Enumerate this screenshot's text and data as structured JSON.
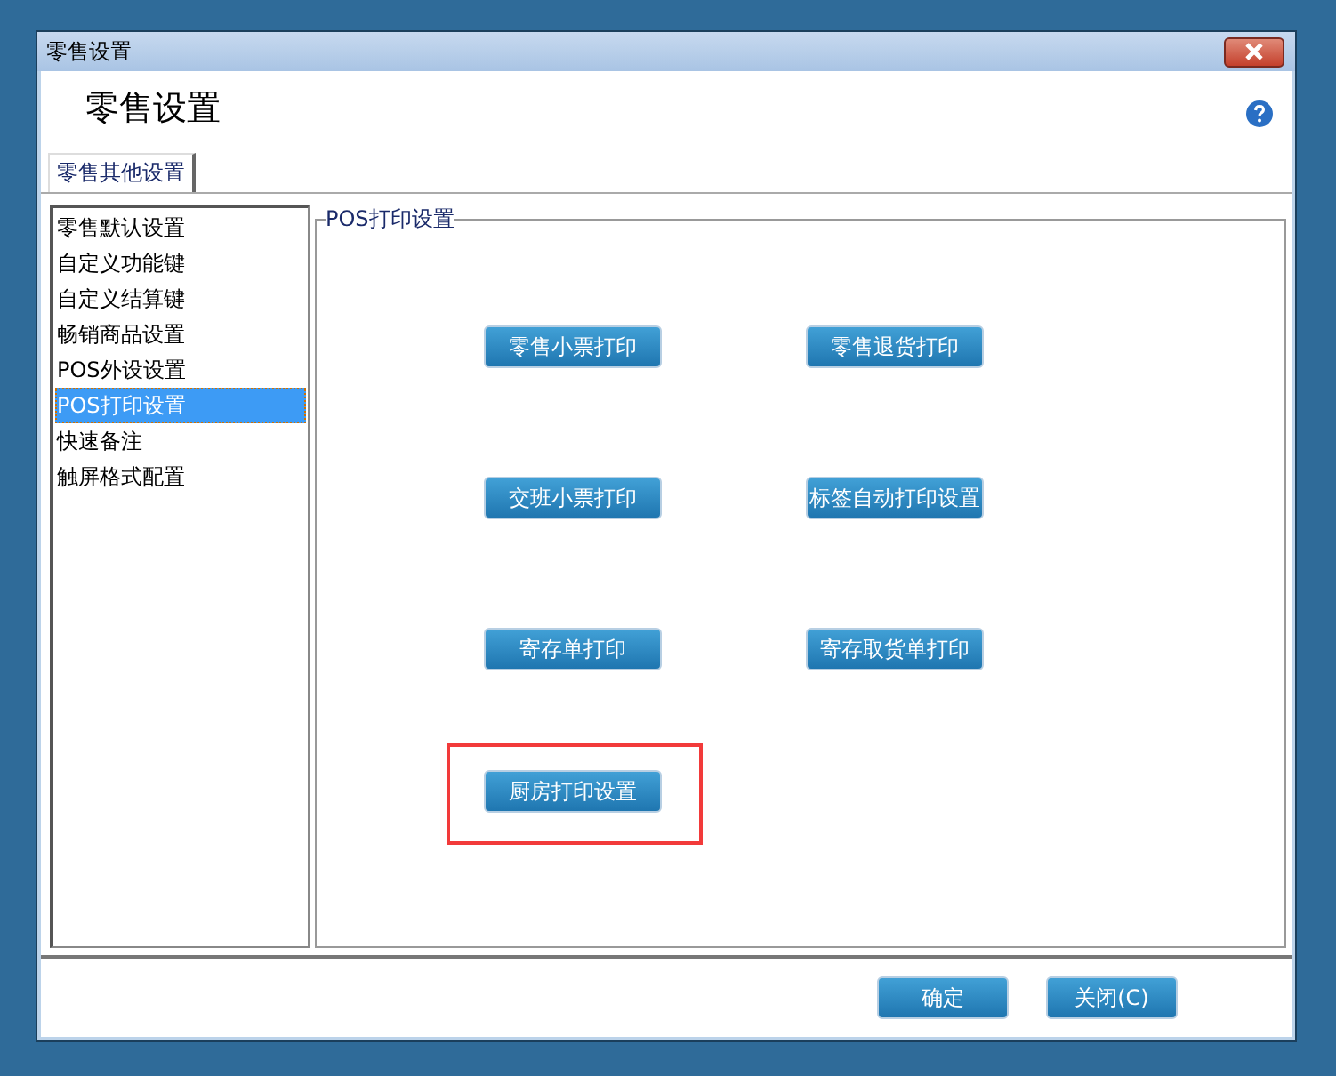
{
  "window": {
    "title": "零售设置"
  },
  "header": {
    "title": "零售设置"
  },
  "tabs": [
    {
      "label": "零售其他设置",
      "selected": true
    }
  ],
  "sidebar": {
    "items": [
      {
        "label": "零售默认设置",
        "selected": false
      },
      {
        "label": "自定义功能键",
        "selected": false
      },
      {
        "label": "自定义结算键",
        "selected": false
      },
      {
        "label": "畅销商品设置",
        "selected": false
      },
      {
        "label": "POS外设设置",
        "selected": false
      },
      {
        "label": "POS打印设置",
        "selected": true
      },
      {
        "label": "快速备注",
        "selected": false
      },
      {
        "label": "触屏格式配置",
        "selected": false
      }
    ]
  },
  "group": {
    "title": "POS打印设置",
    "buttons": [
      {
        "label": "零售小票打印",
        "highlighted": false
      },
      {
        "label": "零售退货打印",
        "highlighted": false
      },
      {
        "label": "交班小票打印",
        "highlighted": false
      },
      {
        "label": "标签自动打印设置",
        "highlighted": false
      },
      {
        "label": "寄存单打印",
        "highlighted": false
      },
      {
        "label": "寄存取货单打印",
        "highlighted": false
      },
      {
        "label": "厨房打印设置",
        "highlighted": true
      }
    ]
  },
  "footer": {
    "buttons": [
      "确定",
      "关闭(C)"
    ]
  }
}
